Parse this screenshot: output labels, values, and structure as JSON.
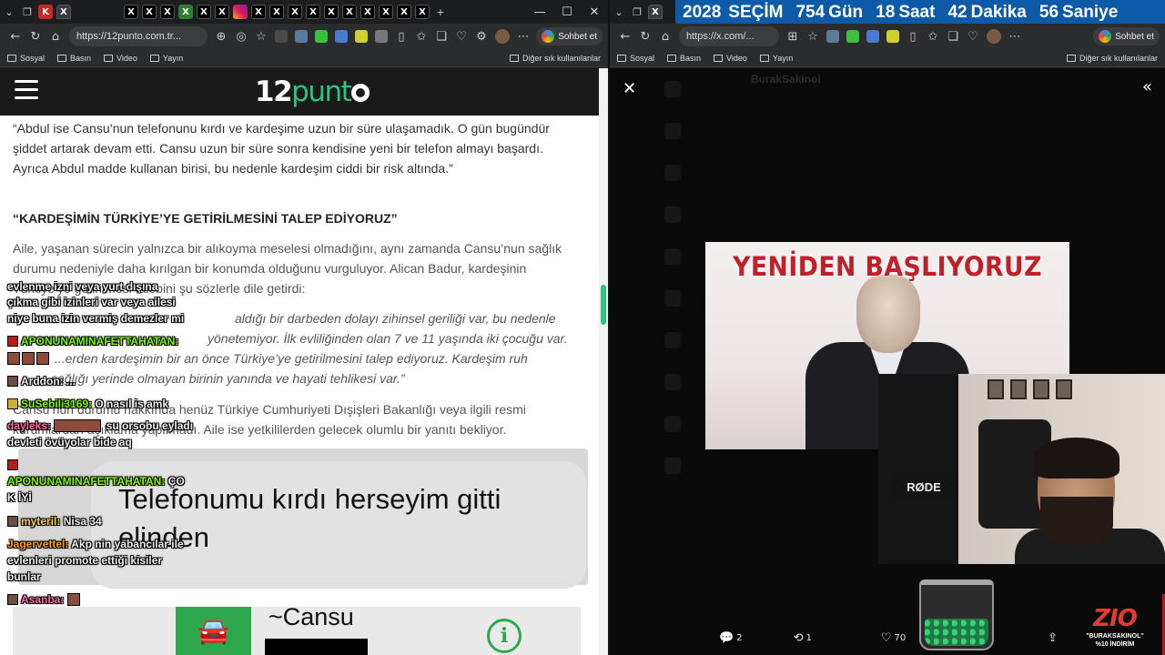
{
  "left_window": {
    "tabs": [
      "K",
      "X",
      "X",
      "X",
      "X",
      "X",
      "X",
      "X",
      "X",
      "X",
      "X",
      "X",
      "X",
      "X",
      "X",
      "X",
      "X",
      "X"
    ],
    "window_controls": [
      "—",
      "☐",
      "✕"
    ],
    "new_tab": "+",
    "url": "https://12punto.com.tr...",
    "copilot_label": "Sohbet et",
    "bookmarks": [
      "Sosyal",
      "Basın",
      "Video",
      "Yayın"
    ],
    "bookmarks_other": "Diğer sık kullanılanlar"
  },
  "site": {
    "logo_num": "12",
    "logo_text": "punt",
    "accent": "#2ec27e"
  },
  "article": {
    "para1": "“Abdul ise Cansu’nun telefonunu kırdı ve kardeşime uzun bir süre ulaşamadık. O gün bugündür şiddet artarak devam etti. Cansu uzun bir süre sonra kendisine yeni bir telefon almayı başardı. Ayrıca Abdul madde kullanan birisi, bu nedenle kardeşim ciddi bir risk altında.”",
    "heading": "“KARDEŞİMİN TÜRKİYE’YE GETİRİLMESİNİ TALEP EDİYORUZ”",
    "para2": "Aile, yaşanan sürecin yalnızca bir alıkoyma meselesi olmadığını, aynı zamanda Cansu’nun sağlık durumu nedeniyle daha kırılgan bir konumda olduğunu vurguluyor. Alican Badur, kardeşinin Türkiye’ye getirilmesi talebini şu sözlerle dile getirdi:",
    "quote_line1": "aldığı bir darbeden dolayı zihinsel geriliği var, bu nedenle",
    "quote_line2": "yönetemiyor. İlk evliliğinden olan 7 ve 11 yaşında iki çocuğu var.",
    "quote_line3": "...erden kardeşimin bir an önce Türkiye’ye getirilmesini talep ediyoruz. Kardeşim ruh",
    "quote_line4": "sağlığı yerinde olmayan birinin yanında ve hayati tehlikesi var.”",
    "para3_line1": "Cansu’nun durumu hakkında henüz Türkiye Cumhuriyeti Dışişleri Bakanlığı veya ilgili resmi",
    "para3_line2": "kurumlardan açıklama yapılmadı. Aile ise yetkililerden gelecek olumlu bir yanıtı bekliyor.",
    "screenshot_bubble": "Telefonumu kırdı herseyim gitti elinden",
    "screenshot_contact": "~Cansu",
    "screenshot_info": "i"
  },
  "chat": [
    {
      "user": "",
      "text": "evlenme izni veya yurt dışına"
    },
    {
      "user": "",
      "text": "çıkma gibi izinleri var veya ailesi"
    },
    {
      "user": "",
      "text": "niye buna izin vermiş demezler mi"
    },
    {
      "user": "APONUNAMINAFETTAHATAN:",
      "text": ""
    },
    {
      "user": "Arddon:",
      "text": "..."
    },
    {
      "user": "SuSebili3169:",
      "text": "O nasıl is amk"
    },
    {
      "user": "dayleks:",
      "text": "su orsobu eyladı"
    },
    {
      "user": "",
      "text": "devleti övüyolar bide aq"
    },
    {
      "user": "APONUNAMINAFETTAHATAN:",
      "text": "ÇO"
    },
    {
      "user": "",
      "text": "K İYİ"
    },
    {
      "user": "myteril:",
      "text": "Nisa 34"
    },
    {
      "user": "Jagervettel:",
      "text": "Akp nin yabancılar ile"
    },
    {
      "user": "",
      "text": "evlenleri promote ettiği kisiler"
    },
    {
      "user": "",
      "text": "bunlar"
    },
    {
      "user": "Asanba:",
      "text": ""
    }
  ],
  "right_window": {
    "url": "https://x.com/...",
    "copilot_label": "Sohbet et",
    "bookmarks": [
      "Sosyal",
      "Basın",
      "Video",
      "Yayın"
    ],
    "bookmarks_other": "Diğer sık kullanılanlar",
    "countdown": {
      "year": "2028",
      "label": "SEÇİM",
      "days": "754",
      "days_label": "Gün",
      "hours": "18",
      "hours_label": "Saat",
      "minutes": "42",
      "minutes_label": "Dakika",
      "seconds": "56",
      "seconds_label": "Saniye"
    },
    "dim_title": "BurakSakinol",
    "video_title": "YENİDEN BAŞLIYORUZ",
    "webcam_mic": "RØDE",
    "actions": {
      "replies": "2",
      "reposts": "1",
      "likes": "70"
    },
    "sponsor_logo": "ZIO",
    "sponsor_tag": "\"BURAKSAKINOL\"",
    "sponsor_discount": "%10 İNDİRİM"
  }
}
